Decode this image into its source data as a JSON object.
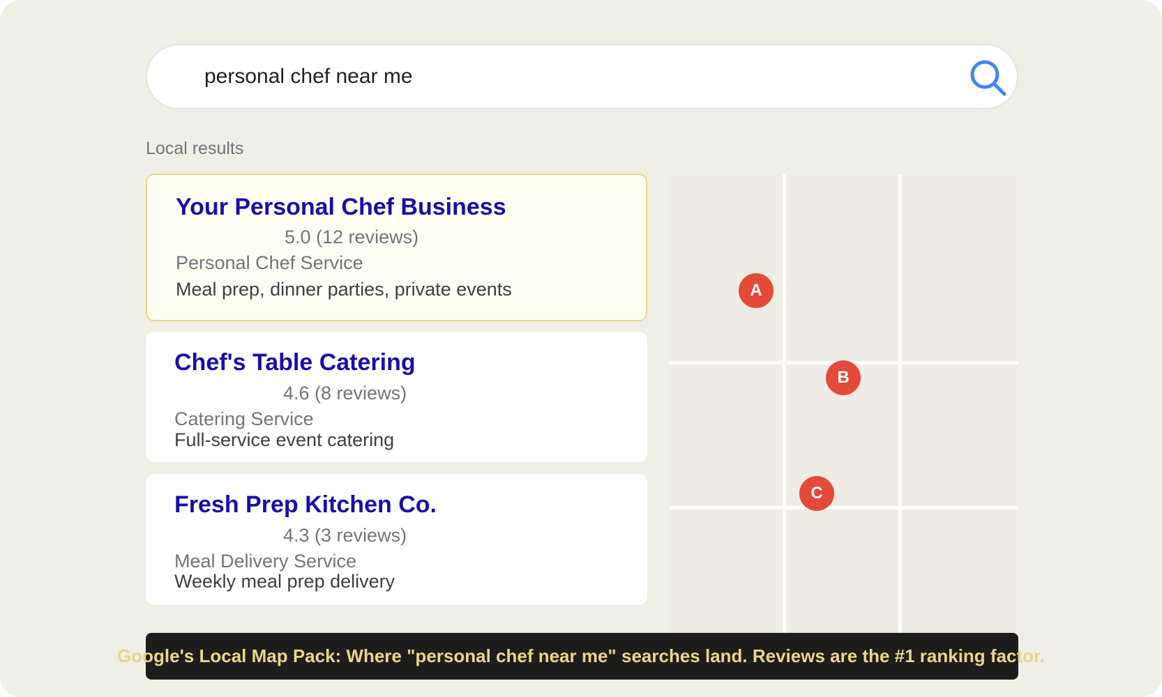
{
  "search": {
    "query": "personal chef near me",
    "icon": "search-icon",
    "icon_color": "#4285f4"
  },
  "section_label": "Local results",
  "results": [
    {
      "name": "Your Personal Chef Business",
      "rating": "5.0 (12 reviews)",
      "category": "Personal Chef Service",
      "description": "Meal prep, dinner parties, private events",
      "highlighted": true
    },
    {
      "name": "Chef's Table Catering",
      "rating": "4.6 (8 reviews)",
      "category": "Catering Service",
      "description": "Full-service event catering",
      "highlighted": false
    },
    {
      "name": "Fresh Prep Kitchen Co.",
      "rating": "4.3 (3 reviews)",
      "category": "Meal Delivery Service",
      "description": "Weekly meal prep delivery",
      "highlighted": false
    }
  ],
  "map": {
    "pins": [
      "A",
      "B",
      "C"
    ],
    "pin_color": "#e34a3a"
  },
  "caption": "Google's Local Map Pack: Where \"personal chef near me\" searches land. Reviews are the #1 ranking factor.",
  "colors": {
    "link": "#1a0dab",
    "caption_text": "#ead58a",
    "highlight_border": "#ead58a"
  }
}
